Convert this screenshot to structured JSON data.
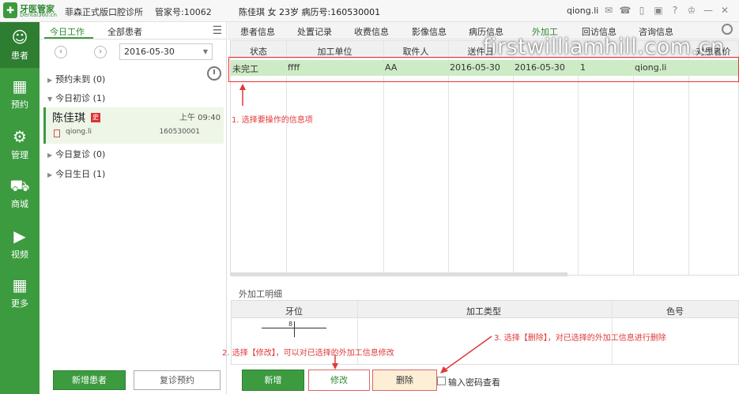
{
  "app": {
    "logo_name": "牙医管家",
    "logo_sub": "Dental360.cn",
    "clinic": "菲森正式版口腔诊所",
    "manager_no": "管家号:10062",
    "patient_header": "陈佳琪 女 23岁  病历号:160530001",
    "user": "qiong.li"
  },
  "sidebar": [
    {
      "label": "患者",
      "icon": "person-icon"
    },
    {
      "label": "预约",
      "icon": "calendar-icon"
    },
    {
      "label": "管理",
      "icon": "gear-icon"
    },
    {
      "label": "商城",
      "icon": "cart-icon"
    },
    {
      "label": "视频",
      "icon": "play-icon"
    },
    {
      "label": "更多",
      "icon": "grid-icon"
    }
  ],
  "left": {
    "tab_today": "今日工作",
    "tab_all": "全部患者",
    "date": "2016-05-30",
    "groups": {
      "unarrived": "预约未到 (0)",
      "first_visit": "今日初诊 (1)",
      "revisit": "今日复诊 (0)",
      "birthday": "今日生日 (1)"
    },
    "card": {
      "name": "陈佳琪",
      "badge": "史",
      "time": "上午 09:40",
      "doctor": "qiong.li",
      "record": "160530001"
    },
    "btn_new_patient": "新增患者",
    "btn_followup": "复诊预约"
  },
  "tabs": [
    "患者信息",
    "处置记录",
    "收费信息",
    "影像信息",
    "病历信息",
    "外加工",
    "回访信息",
    "咨询信息"
  ],
  "grid": {
    "headers": [
      "状态",
      "加工单位",
      "取件人",
      "送件日",
      "",
      "",
      "",
      "对患者价"
    ],
    "row": [
      "未完工",
      "ffff",
      "AA",
      "2016-05-30",
      "2016-05-30",
      "1",
      "qiong.li",
      ""
    ]
  },
  "detail": {
    "label": "外加工明细",
    "headers": [
      "牙位",
      "加工类型",
      "色号"
    ],
    "tooth_number": "8"
  },
  "buttons": {
    "add": "新增",
    "edit": "修改",
    "delete": "删除",
    "password_view": "输入密码查看"
  },
  "annotations": {
    "a1": "1. 选择要操作的信息项",
    "a2": "2. 选择【修改】，可以对已选择的外加工信息修改",
    "a3": "3. 选择【删除】，对已选择的外加工信息进行删除"
  },
  "watermark": "firstwilliamhill.com.cn",
  "colors": {
    "brand_green": "#3c9b3f",
    "selected_row": "#cdebc4",
    "annotation_red": "#e03838"
  }
}
